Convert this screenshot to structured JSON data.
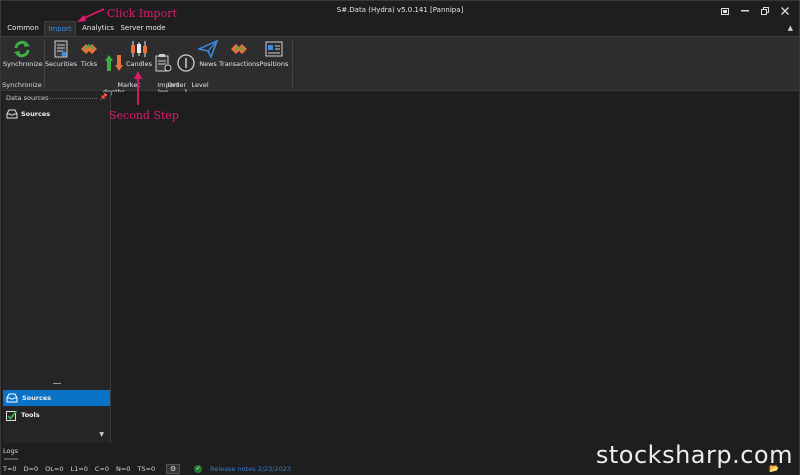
{
  "window": {
    "title": "S#.Data (Hydra) v5.0.141 [Pannipa]"
  },
  "tabs": [
    {
      "label": "Common"
    },
    {
      "label": "Import"
    },
    {
      "label": "Analytics"
    },
    {
      "label": "Server mode"
    }
  ],
  "ribbon": {
    "synchronize_group": {
      "button_label": "Synchronize",
      "group_label": "Synchronize"
    },
    "import_group": {
      "group_label": "Import",
      "buttons": [
        {
          "label": "Securities",
          "icon": "securities-icon"
        },
        {
          "label": "Ticks",
          "icon": "ticks-icon"
        },
        {
          "label": "Market\ndepths",
          "icon": "market-depths-icon"
        },
        {
          "label": "Candles",
          "icon": "candles-icon"
        },
        {
          "label": "Order\nlog",
          "icon": "order-log-icon"
        },
        {
          "label": "Level\n1",
          "icon": "level1-icon"
        },
        {
          "label": "News",
          "icon": "news-icon"
        },
        {
          "label": "Transactions",
          "icon": "transactions-icon"
        },
        {
          "label": "Positions",
          "icon": "positions-icon"
        }
      ]
    }
  },
  "left_panel": {
    "header": "Data sources",
    "tree_item": "Sources",
    "nav": [
      {
        "label": "Sources",
        "active": true
      },
      {
        "label": "Tools",
        "active": false
      }
    ]
  },
  "logs": {
    "label": "Logs"
  },
  "status": {
    "counters": [
      "T=0",
      "D=0",
      "OL=0",
      "L1=0",
      "C=0",
      "N=0",
      "TS=0"
    ],
    "release": "Release notes 2/23/2023"
  },
  "annotations": {
    "click_import": "Click Import",
    "second_step": "Second Step"
  },
  "watermark": "stocksharp.com",
  "colors": {
    "accent": "#0a73c8",
    "annotation": "#e5186d",
    "background": "#1e1e1e",
    "ribbon": "#2d2d30"
  }
}
